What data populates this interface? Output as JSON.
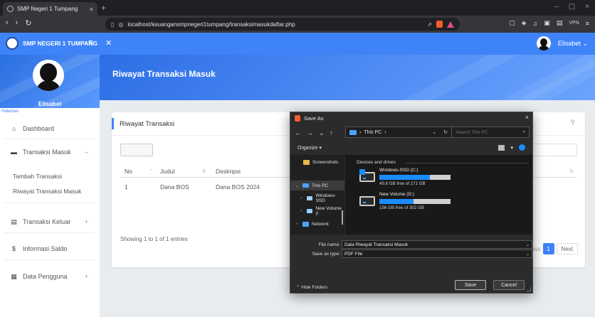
{
  "browser": {
    "tab_title": "SMP Negeri 1 Tumpang",
    "tab_close": "×",
    "new_tab": "+",
    "window_controls": [
      "–",
      "▢",
      "×"
    ],
    "url": "localhost/keuangansmpnegeri1tumpang/transaksimasukdaftar.php",
    "vpn_label": "VPN"
  },
  "app": {
    "school_name": "SMP NEGERI 1 TUMPANG",
    "user_name": "Elisabet",
    "user_caret": "⌄"
  },
  "sidebar": {
    "profile_name": "Elisabet",
    "section_label": "Halaman",
    "items": [
      {
        "label": "Dashboard",
        "sign": ""
      },
      {
        "label": "Transaksi Masuk",
        "sign": "–"
      },
      {
        "label": "Transaksi Keluar",
        "sign": "+"
      },
      {
        "label": "Informasi Saldo",
        "sign": ""
      },
      {
        "label": "Data Pengguna",
        "sign": "+"
      }
    ],
    "subitems": [
      "Tambah Transaksi",
      "Riwayat Transaksi Masuk"
    ]
  },
  "page": {
    "title": "Riwayat Transaksi Masuk",
    "card_title": "Riwayat Transaksi",
    "table": {
      "columns": [
        "No",
        "Judul",
        "Deskripsi"
      ],
      "rows": [
        {
          "no": "1",
          "judul": "Dana BOS",
          "deskripsi": "Dana BOS 2024"
        }
      ]
    },
    "showing_text": "Showing 1 to 1 of 1 entries",
    "pagination": {
      "prev": "ous",
      "current": "1",
      "next": "Next"
    }
  },
  "dialog": {
    "title": "Save As",
    "close": "×",
    "path": "This PC",
    "search_placeholder": "Search This PC",
    "organize": "Organize",
    "nav_items": [
      "Screenshots",
      "This PC",
      "Windows-SSD",
      "New Volume (I",
      "Network"
    ],
    "group_title": "Devices and drives",
    "drives": [
      {
        "name": "Windows-SSD (C:)",
        "free_text": "49,6 GB free of 171 GB",
        "used_fraction": 0.71
      },
      {
        "name": "New Volume (D:)",
        "free_text": "156 GB free of 302 GB",
        "used_fraction": 0.48
      }
    ],
    "file_name_label": "File name:",
    "file_name_value": "Data Riwayat Transaksi Masuk",
    "save_type_label": "Save as type:",
    "save_type_value": "PDF File",
    "hide_folders": "Hide Folders",
    "save_button": "Save",
    "cancel_button": "Cancel"
  },
  "colors": {
    "accent": "#3f83f8",
    "dialog_bg": "#2b2b2b",
    "drive_bar": "#1a8cff"
  }
}
